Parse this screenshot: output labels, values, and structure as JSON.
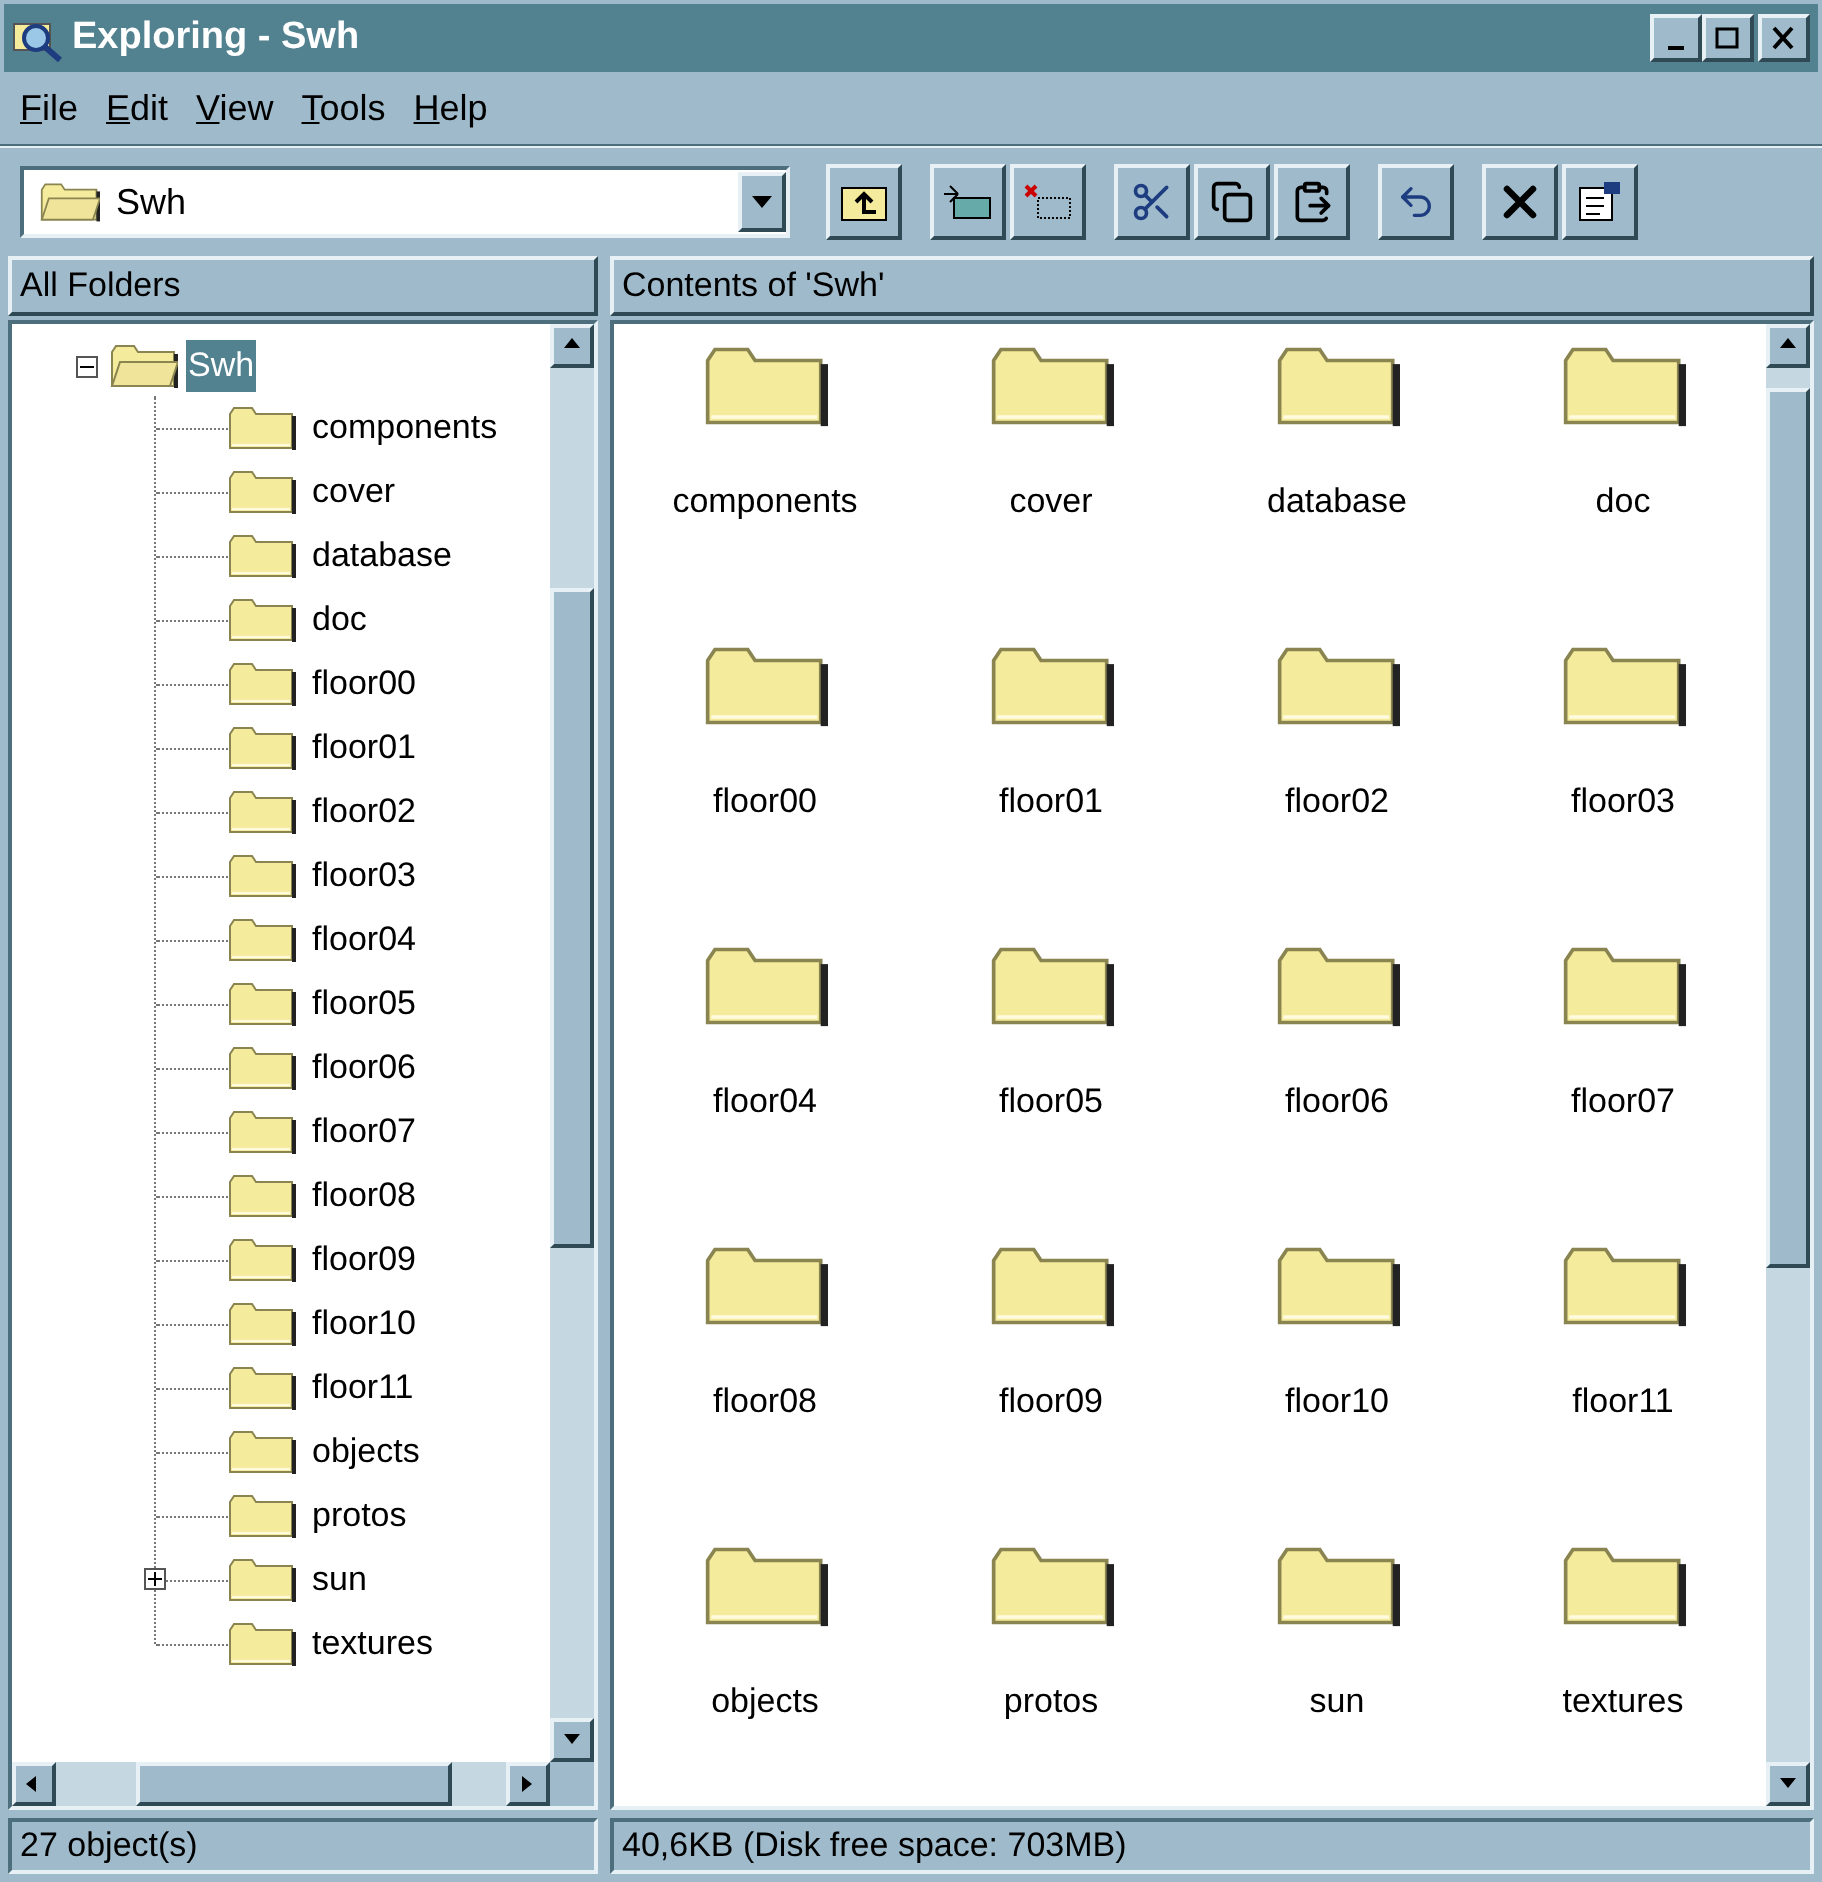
{
  "window": {
    "title": "Exploring - Swh"
  },
  "menu": [
    "File",
    "Edit",
    "View",
    "Tools",
    "Help"
  ],
  "address": {
    "value": "Swh"
  },
  "panes": {
    "left_header": "All Folders",
    "right_header": "Contents of 'Swh'"
  },
  "tree": [
    {
      "label": "Swh",
      "expanded": true,
      "selected": true,
      "children": [
        {
          "label": "components",
          "expandable": false
        },
        {
          "label": "cover",
          "expandable": false
        },
        {
          "label": "database",
          "expandable": false
        },
        {
          "label": "doc",
          "expandable": false
        },
        {
          "label": "floor00",
          "expandable": false
        },
        {
          "label": "floor01",
          "expandable": false
        },
        {
          "label": "floor02",
          "expandable": false
        },
        {
          "label": "floor03",
          "expandable": false
        },
        {
          "label": "floor04",
          "expandable": false
        },
        {
          "label": "floor05",
          "expandable": false
        },
        {
          "label": "floor06",
          "expandable": false
        },
        {
          "label": "floor07",
          "expandable": false
        },
        {
          "label": "floor08",
          "expandable": false
        },
        {
          "label": "floor09",
          "expandable": false
        },
        {
          "label": "floor10",
          "expandable": false
        },
        {
          "label": "floor11",
          "expandable": false
        },
        {
          "label": "objects",
          "expandable": false
        },
        {
          "label": "protos",
          "expandable": false
        },
        {
          "label": "sun",
          "expandable": true
        },
        {
          "label": "textures",
          "expandable": false
        }
      ]
    }
  ],
  "contents": [
    "components",
    "cover",
    "database",
    "doc",
    "floor00",
    "floor01",
    "floor02",
    "floor03",
    "floor04",
    "floor05",
    "floor06",
    "floor07",
    "floor08",
    "floor09",
    "floor10",
    "floor11",
    "objects",
    "protos",
    "sun",
    "textures"
  ],
  "status_bar": [
    "27 object(s)",
    "40,6KB (Disk free space: 703MB)"
  ]
}
